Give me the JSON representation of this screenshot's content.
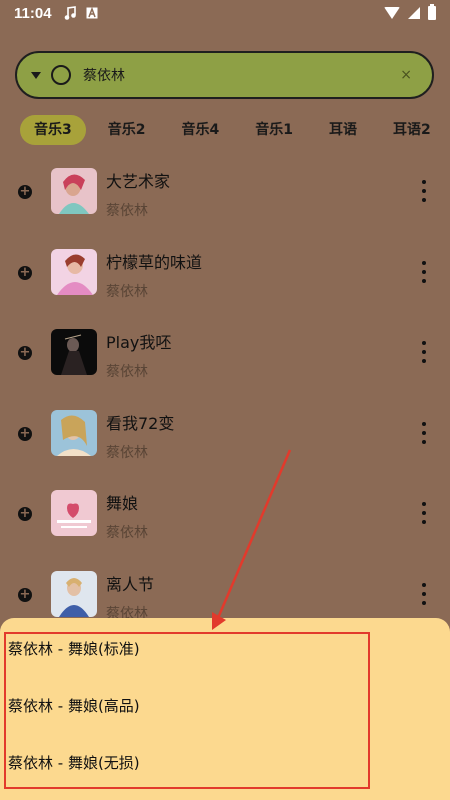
{
  "status_bar": {
    "time": "11:04",
    "icons": [
      "music-note-icon",
      "a-letter-icon",
      "wifi-icon",
      "cell-signal-icon",
      "battery-icon"
    ]
  },
  "search": {
    "value": "蔡依林",
    "clear": "×"
  },
  "tabs": [
    {
      "label": "音乐3",
      "active": true
    },
    {
      "label": "音乐2",
      "active": false
    },
    {
      "label": "音乐4",
      "active": false
    },
    {
      "label": "音乐1",
      "active": false
    },
    {
      "label": "耳语",
      "active": false
    },
    {
      "label": "耳语2",
      "active": false
    }
  ],
  "songs": [
    {
      "title": "大艺术家",
      "artist": "蔡依林"
    },
    {
      "title": "柠檬草的味道",
      "artist": "蔡依林"
    },
    {
      "title": "Play我呸",
      "artist": "蔡依林"
    },
    {
      "title": "看我72变",
      "artist": "蔡依林"
    },
    {
      "title": "舞娘",
      "artist": "蔡依林"
    },
    {
      "title": "离人节",
      "artist": "蔡依林"
    }
  ],
  "quality_options": [
    "蔡依林 - 舞娘(标准)",
    "蔡依林 - 舞娘(高品)",
    "蔡依林 - 舞娘(无损)"
  ],
  "colors": {
    "background": "#8b6a55",
    "search_bg": "#8ea045",
    "tab_active": "#a8a23a",
    "sheet_bg": "#fcd98f",
    "annotation_red": "#e23a2c"
  }
}
